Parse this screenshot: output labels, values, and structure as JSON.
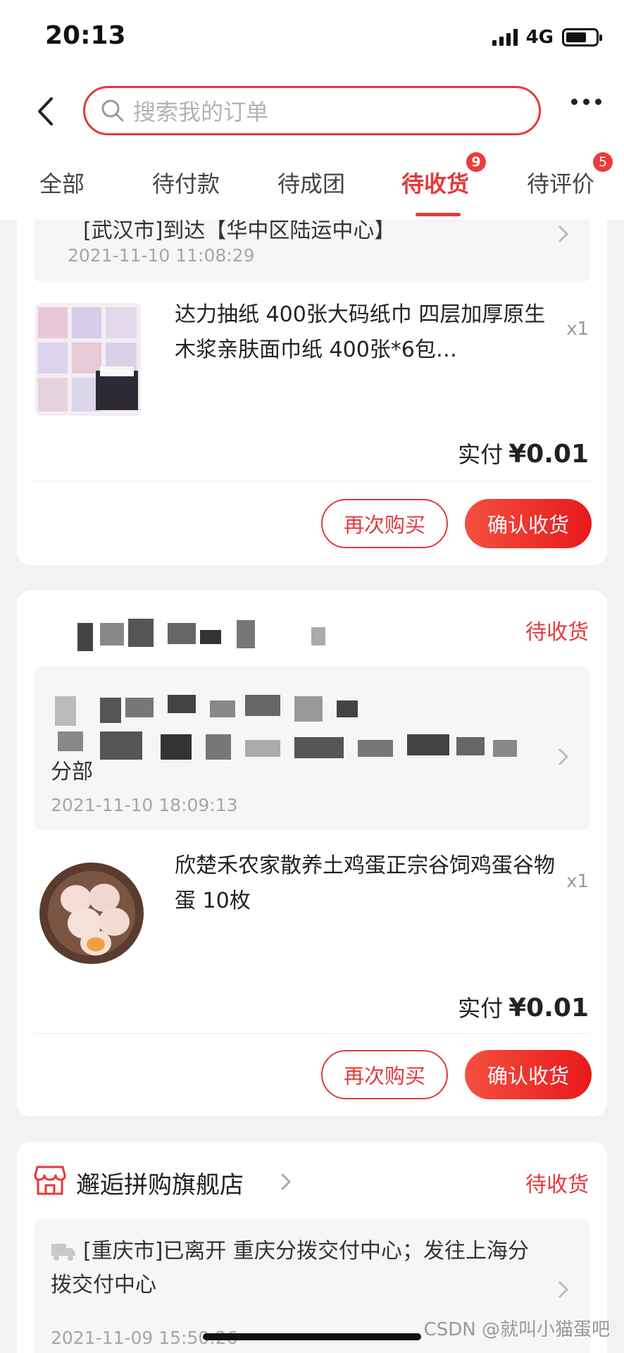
{
  "status_bar": {
    "time": "20:13",
    "network": "4G",
    "battery_level": 0.7
  },
  "search": {
    "placeholder": "搜索我的订单"
  },
  "tabs": [
    {
      "label": "全部"
    },
    {
      "label": "待付款"
    },
    {
      "label": "待成团"
    },
    {
      "label": "待收货",
      "badge": "9",
      "active": true
    },
    {
      "label": "待评价",
      "badge": "5"
    }
  ],
  "orders": [
    {
      "logistics": {
        "text": "[武汉市]到达【华中区陆运中心】",
        "time": "2021-11-10 11:08:29"
      },
      "product": {
        "title": "达力抽纸 400张大码纸巾 四层加厚原生木浆亲肤面巾纸 400张*6包…",
        "qty": "x1"
      },
      "paid_label": "实付",
      "paid_amount": "¥0.01",
      "rebuy_label": "再次购买",
      "confirm_label": "确认收货"
    },
    {
      "status": "待收货",
      "logistics": {
        "text_tail": "分部",
        "time": "2021-11-10 18:09:13"
      },
      "product": {
        "title": "欣楚禾农家散养土鸡蛋正宗谷饲鸡蛋谷物蛋 10枚",
        "qty": "x1"
      },
      "paid_label": "实付",
      "paid_amount": "¥0.01",
      "rebuy_label": "再次购买",
      "confirm_label": "确认收货"
    },
    {
      "store": "邂逅拼购旗舰店",
      "status": "待收货",
      "logistics": {
        "text": "[重庆市]已离开 重庆分拨交付中心；发往上海分拨交付中心",
        "time": "2021-11-09 15:50:26"
      }
    }
  ],
  "watermark": "CSDN @就叫小猫蛋吧",
  "colors": {
    "accent": "#e4393c",
    "badge": "#ea3d3d",
    "button_gradient_start": "#f4503f",
    "button_gradient_end": "#e8191c"
  }
}
